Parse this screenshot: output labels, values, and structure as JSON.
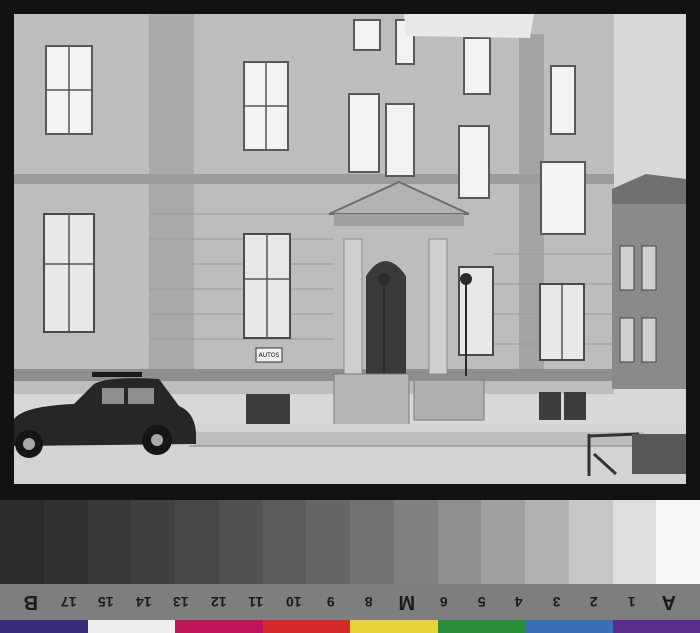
{
  "sign": {
    "text": "AUTOS",
    "subtext": ""
  },
  "scale": {
    "labels": [
      "B",
      "17",
      "15",
      "14",
      "13",
      "12",
      "11",
      "10",
      "9",
      "8",
      "M",
      "6",
      "5",
      "4",
      "3",
      "2",
      "1",
      "A"
    ]
  },
  "colors": {
    "grayscale": [
      "#2c2c2c",
      "#323232",
      "#393939",
      "#404040",
      "#484848",
      "#515151",
      "#5b5b5b",
      "#666666",
      "#727272",
      "#808080",
      "#8f8f8f",
      "#9f9f9f",
      "#b2b2b2",
      "#c7c7c7",
      "#dedede",
      "#f7f7f7"
    ],
    "colorbar": [
      "#3a2a7a",
      "#efefef",
      "#c2145a",
      "#d62a2a",
      "#e8d43a",
      "#2a8e3a",
      "#3b6fb8",
      "#5a2c8c"
    ]
  }
}
